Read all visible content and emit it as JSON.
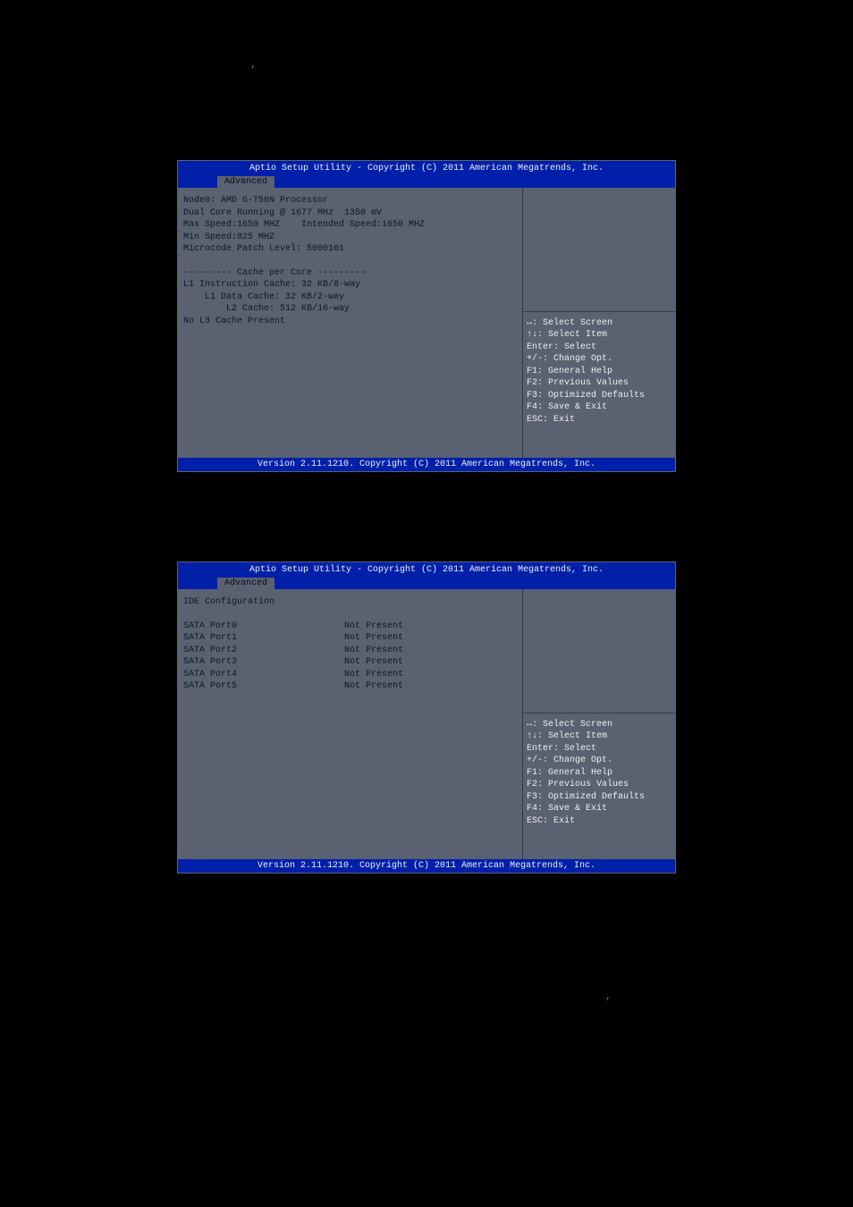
{
  "punct_top": ",",
  "punct_bottom": ",",
  "header_title": "Aptio Setup Utility - Copyright (C) 2011 American Megatrends, Inc.",
  "tab_label": "Advanced",
  "footer_text": "Version 2.11.1210. Copyright (C) 2011 American Megatrends, Inc.",
  "help": {
    "l1": "↔: Select Screen",
    "l2": "↑↓: Select Item",
    "l3": "Enter: Select",
    "l4": "+/-: Change Opt.",
    "l5": "F1: General Help",
    "l6": "F2: Previous Values",
    "l7": "F3: Optimized Defaults",
    "l8": "F4: Save & Exit",
    "l9": "ESC: Exit"
  },
  "screen1": {
    "node_line": "Node0: AMD G-T56N Processor",
    "dual_core": "Dual Core Running @ 1677 MHz  1350 mV",
    "max_speed": "Max Speed:1650 MHZ    Intended Speed:1650 MHZ",
    "min_speed": "Min Speed:825 MHZ",
    "microcode": "Microcode Patch Level: 5000101",
    "cache_header": "--------- Cache per Core ---------",
    "l1_instr": "L1 Instruction Cache: 32 KB/8-way",
    "l1_data": "L1 Data Cache: 32 KB/2-way",
    "l2_cache": "L2 Cache: 512 KB/16-way",
    "no_l3": "No L3 Cache Present"
  },
  "screen2": {
    "title": "IDE Configuration",
    "ports": [
      {
        "label": "SATA Port0",
        "status": "Not Present"
      },
      {
        "label": "SATA Port1",
        "status": "Not Present"
      },
      {
        "label": "SATA Port2",
        "status": "Not Present"
      },
      {
        "label": "SATA Port3",
        "status": "Not Present"
      },
      {
        "label": "SATA Port4",
        "status": "Not Present"
      },
      {
        "label": "SATA Port5",
        "status": "Not Present"
      }
    ]
  }
}
